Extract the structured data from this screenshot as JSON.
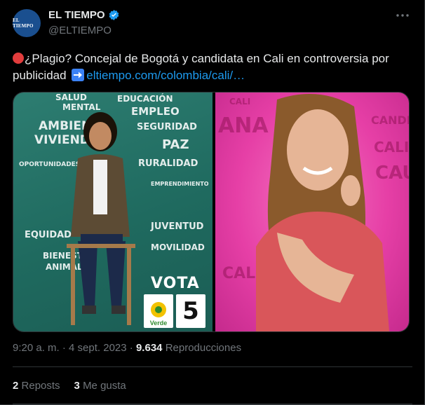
{
  "account": {
    "avatar_text": "EL TIEMPO",
    "name": "EL TIEMPO",
    "handle": "@ELTIEMPO",
    "verified": true
  },
  "tweet": {
    "text": "¿Plagio? Concejal de Bogotá y candidata en Cali en controversia por publicidad",
    "link_text": "eltiempo.com/colombia/cali/…"
  },
  "media": {
    "left_words": [
      "SALUD",
      "MENTAL",
      "EDUCACIÓN",
      "EMPLEO",
      "AMBIENTE",
      "VIVIENDA",
      "SEGURIDAD",
      "PAZ",
      "RURALIDAD",
      "OPORTUNIDADES",
      "EMPRENDIMIENTO",
      "EQUIDAD",
      "JUVENTUD",
      "BIENESTAR",
      "ANIMAL",
      "MOVILIDAD"
    ],
    "vota": "VOTA",
    "verde": "Verde",
    "number": "5",
    "right_words": [
      "ANA",
      "CALI",
      "CALI",
      "CANDI",
      "CALI",
      "CAU"
    ]
  },
  "meta": {
    "time": "9:20 a. m.",
    "separator": "·",
    "date": "4 sept. 2023",
    "views_count": "9.634",
    "views_label": "Reproducciones"
  },
  "stats": {
    "reposts_count": "2",
    "reposts_label": "Reposts",
    "likes_count": "3",
    "likes_label": "Me gusta"
  },
  "colors": {
    "background": "#000000",
    "text": "#e7e9ea",
    "muted": "#71767b",
    "link": "#1d9bf0",
    "verified": "#1d9bf0"
  }
}
